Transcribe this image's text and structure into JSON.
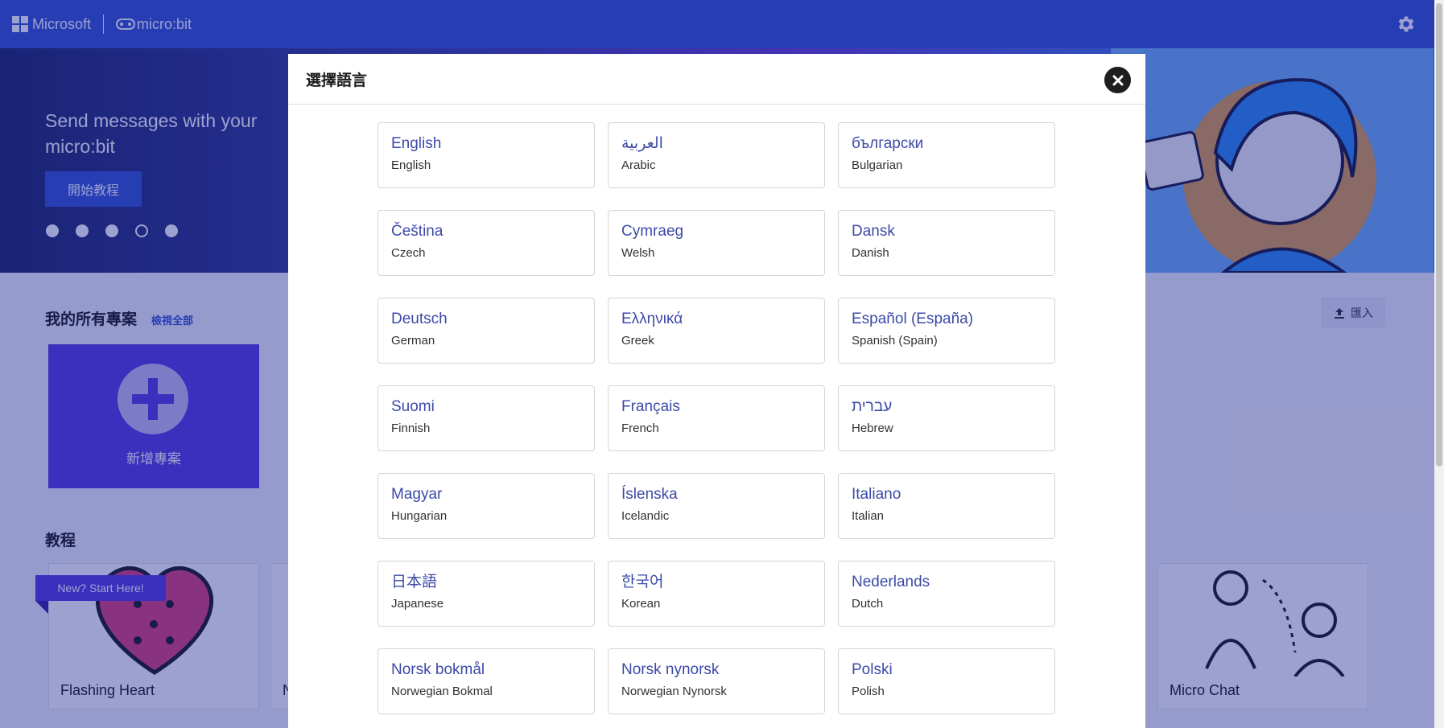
{
  "topbar": {
    "brand": "Microsoft",
    "product": "micro:bit"
  },
  "hero": {
    "title": "Send messages with your micro:bit",
    "button": "開始教程",
    "dots_total": 5,
    "active_dot": 4
  },
  "projects": {
    "title": "我的所有專案",
    "view_all": "檢視全部",
    "new_project": "新增專案",
    "import": "匯入"
  },
  "tutorials": {
    "title": "教程",
    "ribbon": "New? Start Here!",
    "cards": [
      {
        "title": "Flashing Heart"
      },
      {
        "title": "N"
      },
      {
        "title": "Micro Chat"
      }
    ]
  },
  "modal": {
    "title": "選擇語言",
    "languages": [
      {
        "native": "English",
        "english": "English"
      },
      {
        "native": "العربية",
        "english": "Arabic"
      },
      {
        "native": "български",
        "english": "Bulgarian"
      },
      {
        "native": "Čeština",
        "english": "Czech"
      },
      {
        "native": "Cymraeg",
        "english": "Welsh"
      },
      {
        "native": "Dansk",
        "english": "Danish"
      },
      {
        "native": "Deutsch",
        "english": "German"
      },
      {
        "native": "Ελληνικά",
        "english": "Greek"
      },
      {
        "native": "Español (España)",
        "english": "Spanish (Spain)"
      },
      {
        "native": "Suomi",
        "english": "Finnish"
      },
      {
        "native": "Français",
        "english": "French"
      },
      {
        "native": "עברית",
        "english": "Hebrew"
      },
      {
        "native": "Magyar",
        "english": "Hungarian"
      },
      {
        "native": "Íslenska",
        "english": "Icelandic"
      },
      {
        "native": "Italiano",
        "english": "Italian"
      },
      {
        "native": "日本語",
        "english": "Japanese"
      },
      {
        "native": "한국어",
        "english": "Korean"
      },
      {
        "native": "Nederlands",
        "english": "Dutch"
      },
      {
        "native": "Norsk bokmål",
        "english": "Norwegian Bokmal"
      },
      {
        "native": "Norsk nynorsk",
        "english": "Norwegian Nynorsk"
      },
      {
        "native": "Polski",
        "english": "Polish"
      }
    ]
  },
  "colors": {
    "topbar": "#3454d1",
    "accent_purple": "#5b3be0",
    "language_text": "#3c4aa8"
  }
}
